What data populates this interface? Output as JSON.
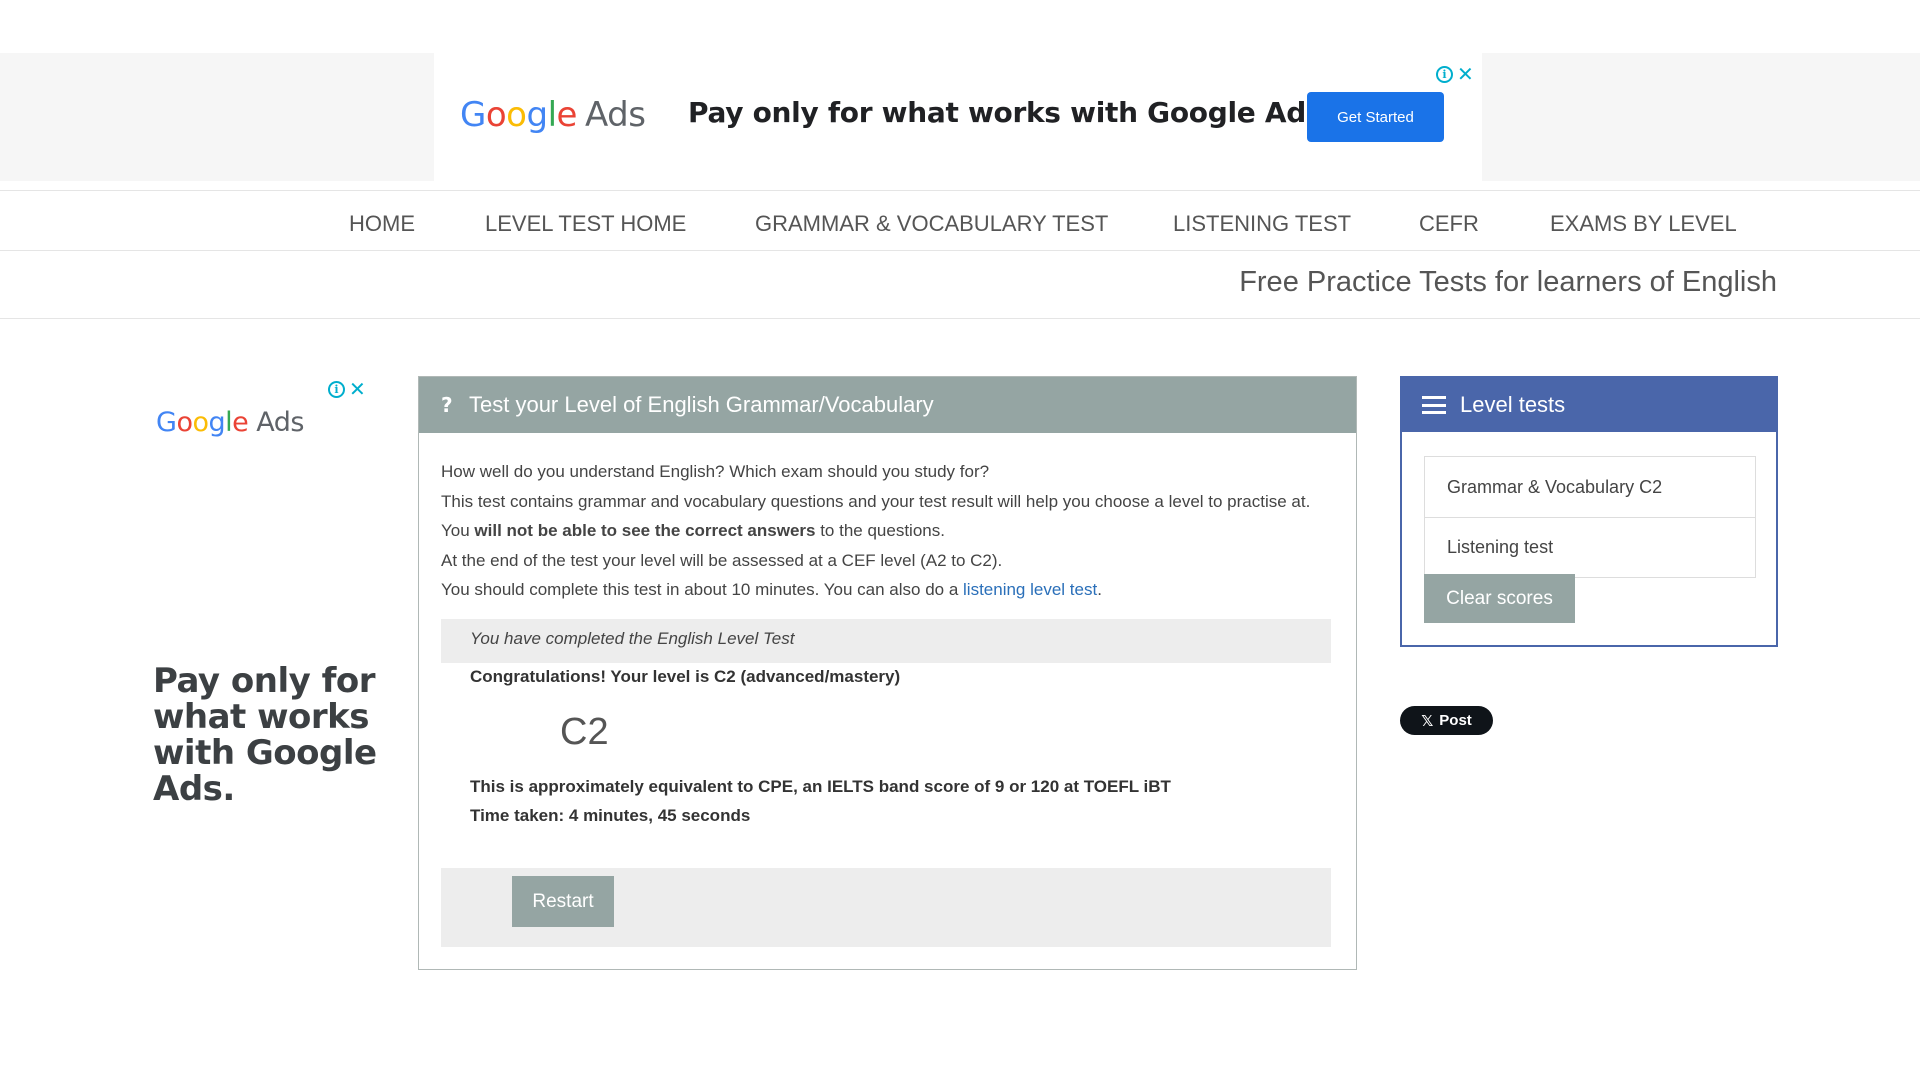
{
  "top_ad": {
    "logo_letters": [
      "G",
      "o",
      "o",
      "g",
      "l",
      "e"
    ],
    "logo_suffix": "Ads",
    "headline": "Pay only for what works with Google Ads.",
    "cta": "Get Started",
    "info": "i",
    "close": "✕"
  },
  "nav": {
    "items": [
      "HOME",
      "LEVEL TEST HOME",
      "GRAMMAR & VOCABULARY TEST",
      "LISTENING TEST",
      "CEFR",
      "EXAMS BY LEVEL"
    ]
  },
  "tagline": "Free Practice Tests for learners of English",
  "left_ad": {
    "logo_suffix": "Ads",
    "text": "Pay only for what works with Google Ads.",
    "info": "i",
    "close": "✕"
  },
  "main": {
    "icon": "question-icon",
    "icon_glyph": "?",
    "title": "Test your Level of English Grammar/Vocabulary",
    "intro": {
      "line1": "How well do you understand English? Which exam should you study for?",
      "line2": "This test contains grammar and vocabulary questions and your test result will help you choose a level to practise at. You ",
      "line2_bold": "will not be able to see the correct answers",
      "line2_end": " to the questions.",
      "line3": "At the end of the test your level will be assessed at a CEF level (A2 to C2).",
      "line4": "You should complete this test in about 10 minutes. You can also do a ",
      "line4_link": "listening level test",
      "line4_end": "."
    },
    "completed": "You have completed the English Level Test",
    "congrats": "Congratulations! Your level is C2 (advanced/mastery)",
    "level": "C2",
    "equivalent": "This is approximately equivalent to CPE, an IELTS band score of 9 or 120 at TOEFL iBT",
    "time_taken": "Time taken: 4 minutes, 45 seconds",
    "restart": "Restart"
  },
  "side": {
    "icon": "list-icon",
    "title": "Level tests",
    "items": [
      "Grammar & Vocabulary C2",
      "Listening test"
    ],
    "clear": "Clear scores"
  },
  "social": {
    "x_glyph": "𝕏",
    "label": "Post"
  },
  "colors": {
    "panel_header": "#95a5a3",
    "side_header": "#4a66aa",
    "ad_cta": "#1a73e8",
    "link": "#2a6fb9"
  }
}
